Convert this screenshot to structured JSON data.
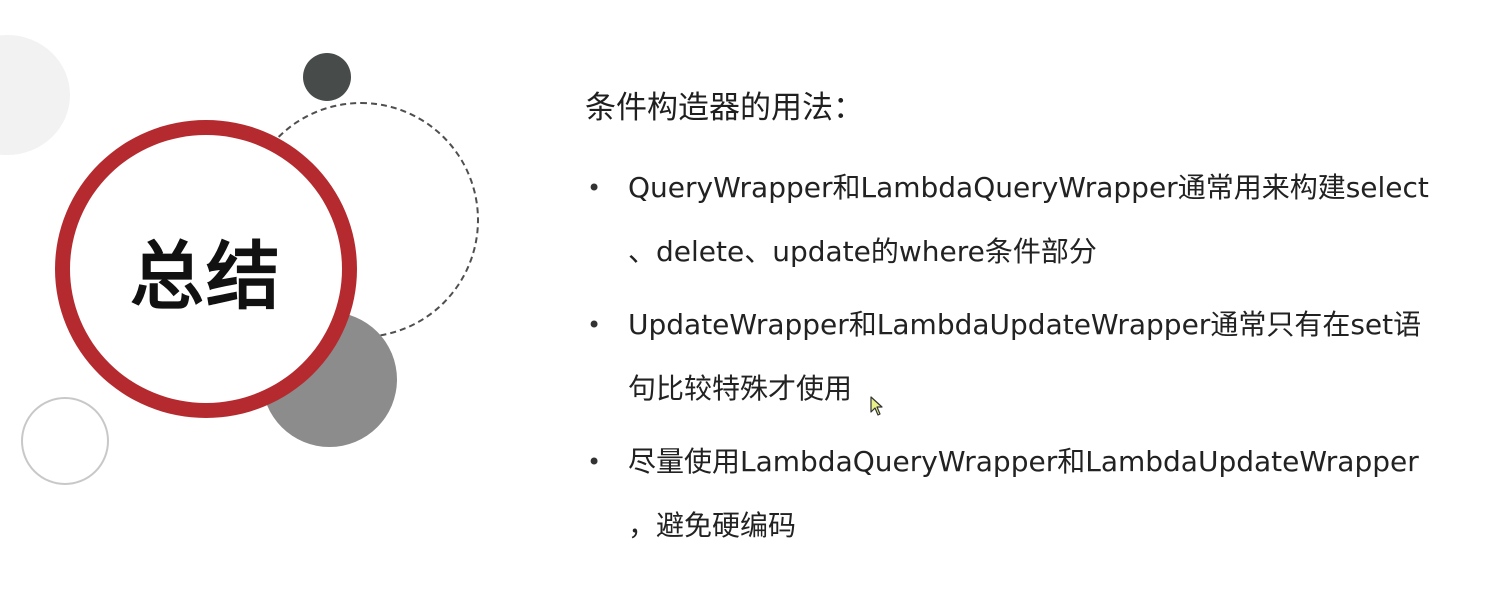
{
  "title_badge": {
    "text": "总结",
    "ring_color": "#b52a2e"
  },
  "heading": "条件构造器的用法：",
  "bullets": [
    {
      "line1": "QueryWrapper和LambdaQueryWrapper通常用来构建select",
      "line2": "、delete、update的where条件部分"
    },
    {
      "line1": "UpdateWrapper和LambdaUpdateWrapper通常只有在set语",
      "line2": "句比较特殊才使用"
    },
    {
      "line1": "尽量使用LambdaQueryWrapper和LambdaUpdateWrapper",
      "line2": "，避免硬编码"
    }
  ],
  "bullet_symbol": "•",
  "cursor": {
    "icon": "mouse-pointer-icon",
    "color": "#e8f08a"
  }
}
